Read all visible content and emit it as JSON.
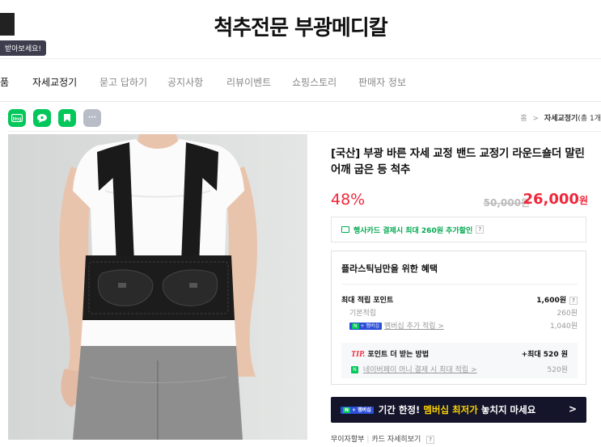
{
  "store": {
    "title": "척추전문 부광메디칼",
    "tooltip": "받아보세요!"
  },
  "nav": {
    "items": [
      "품",
      "자세교정기",
      "묻고 답하기",
      "공지사항",
      "리뷰이벤트",
      "쇼핑스토리",
      "판매자 정보"
    ]
  },
  "share": {
    "icons": [
      "blog-share-icon",
      "talk-share-icon",
      "bookmark-share-icon",
      "more-icon"
    ],
    "more_label": "···"
  },
  "breadcrumb": {
    "home": "홈",
    "sep": ">",
    "current": "자세교정기",
    "count": "(총 1개"
  },
  "product": {
    "name": "[국산] 부광 바른 자세 교정 밴드 교정기 라운드숄더 말린 어깨 굽은 등 척추",
    "discount": "48%",
    "original_price": "50,000원",
    "sale_price": "26,000",
    "sale_unit": "원"
  },
  "card_promo": {
    "text": "행사카드 결제시 최대 260원 추가할인",
    "help": "?"
  },
  "benefit": {
    "title": "플라스틱님만을 위한 혜택",
    "max_points_label": "최대 적립 포인트",
    "max_points_value": "1,600원",
    "basic_label": "기본적립",
    "basic_value": "260원",
    "membership_badge_n": "N",
    "membership_badge_plus": "+ 멤버십",
    "membership_label": "멤버십 추가 적립 >",
    "membership_value": "1,040원",
    "tip_prefix": "TIP.",
    "tip_label": "포인트 더 받는 방법",
    "tip_value": "+최대 520 원",
    "npay_badge": "N",
    "npay_label": "네이버페이 머니 결제 시 최대 적립 >",
    "npay_value": "520원",
    "help": "?"
  },
  "promo_banner": {
    "badge_n": "N",
    "badge_plus": "+ 멤버십",
    "text_pre": "기간 한정!",
    "text_hl": "멤버십 최저가",
    "text_post": "놓치지 마세요",
    "arrow": ">"
  },
  "installment": {
    "label": "무이자할부",
    "link": "카드 자세히보기",
    "help": "?"
  },
  "colors": {
    "sale_red": "#f0273b",
    "naver_green": "#03c75a",
    "banner_dark": "#14152b",
    "highlight_yellow": "#ffd400"
  }
}
